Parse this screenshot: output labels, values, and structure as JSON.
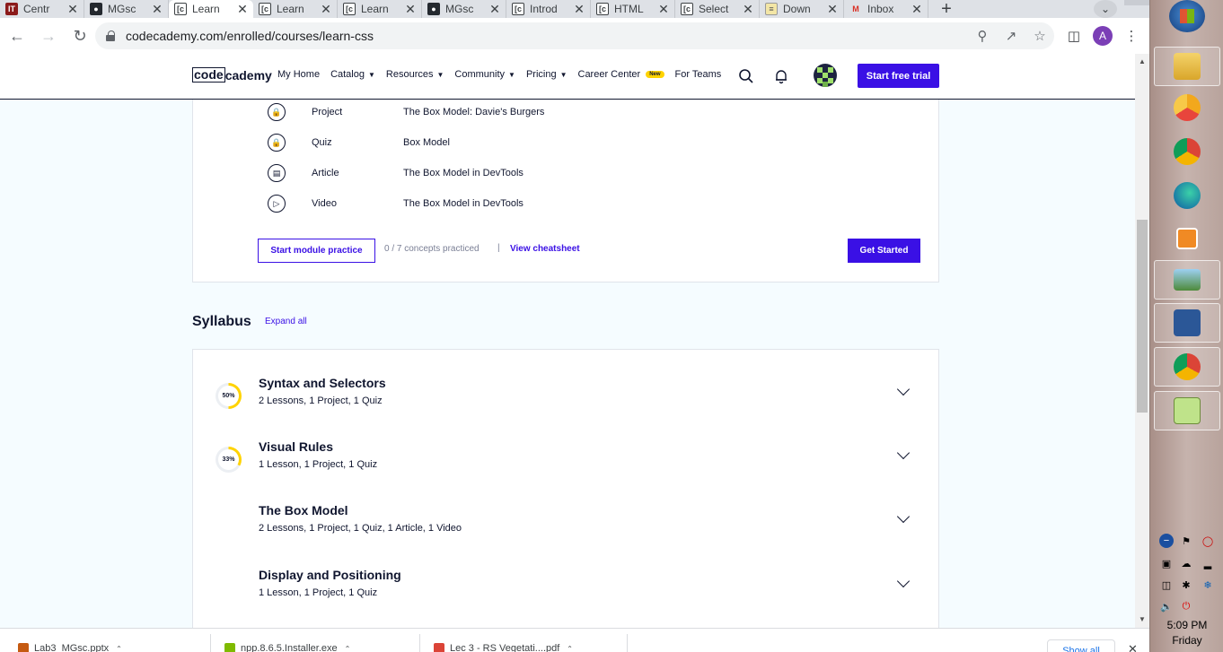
{
  "browser": {
    "tabs": [
      {
        "title": "Centr",
        "favicon": "it-icon",
        "active": false
      },
      {
        "title": "MGsc",
        "favicon": "github-icon",
        "active": false
      },
      {
        "title": "Learn",
        "favicon": "codecademy-icon",
        "active": true
      },
      {
        "title": "Learn",
        "favicon": "codecademy-icon",
        "active": false
      },
      {
        "title": "Learn",
        "favicon": "codecademy-icon",
        "active": false
      },
      {
        "title": "MGsc",
        "favicon": "github-icon",
        "active": false
      },
      {
        "title": "Introd",
        "favicon": "codecademy-icon",
        "active": false
      },
      {
        "title": "HTML",
        "favicon": "codecademy-icon",
        "active": false
      },
      {
        "title": "Select",
        "favicon": "codecademy-icon",
        "active": false
      },
      {
        "title": "Down",
        "favicon": "document-icon",
        "active": false
      },
      {
        "title": "Inbox",
        "favicon": "gmail-icon",
        "active": false
      }
    ],
    "url": "codecademy.com/enrolled/courses/learn-css",
    "profile_initial": "A"
  },
  "site": {
    "logo_code": "code",
    "logo_cademy": "cademy",
    "nav": [
      {
        "label": "My Home",
        "caret": false
      },
      {
        "label": "Catalog",
        "caret": true
      },
      {
        "label": "Resources",
        "caret": true
      },
      {
        "label": "Community",
        "caret": true
      },
      {
        "label": "Pricing",
        "caret": true
      },
      {
        "label": "Career Center",
        "caret": false,
        "badge": "New"
      },
      {
        "label": "For Teams",
        "caret": false
      }
    ],
    "trial_button": "Start free trial"
  },
  "module": {
    "items": [
      {
        "icon": "lock-icon",
        "type": "Project",
        "name": "The Box Model: Davie's Burgers"
      },
      {
        "icon": "lock-icon",
        "type": "Quiz",
        "name": "Box Model"
      },
      {
        "icon": "article-icon",
        "type": "Article",
        "name": "The Box Model in DevTools"
      },
      {
        "icon": "play-icon",
        "type": "Video",
        "name": "The Box Model in DevTools"
      }
    ],
    "practice_button": "Start module practice",
    "practice_count": "0 / 7 concepts practiced",
    "separator": "|",
    "cheatsheet_link": "View cheatsheet",
    "start_button": "Get Started"
  },
  "syllabus": {
    "title": "Syllabus",
    "expand_all": "Expand all",
    "modules": [
      {
        "title": "Syntax and Selectors",
        "subtitle": "2 Lessons, 1 Project, 1 Quiz",
        "progress": "50%",
        "progress_value": 50
      },
      {
        "title": "Visual Rules",
        "subtitle": "1 Lesson, 1 Project, 1 Quiz",
        "progress": "33%",
        "progress_value": 33
      },
      {
        "title": "The Box Model",
        "subtitle": "2 Lessons, 1 Project, 1 Quiz, 1 Article, 1 Video",
        "progress": "",
        "progress_value": null
      },
      {
        "title": "Display and Positioning",
        "subtitle": "1 Lesson, 1 Project, 1 Quiz",
        "progress": "",
        "progress_value": null
      }
    ]
  },
  "downloads": {
    "items": [
      "Lab3_MGsc.pptx",
      "npp.8.6.5.Installer.exe",
      "Lec 3 - RS Vegetati....pdf"
    ],
    "show_all": "Show all"
  },
  "taskbar": {
    "time": "5:09 PM",
    "day": "Friday"
  },
  "colors": {
    "brand": "#3a10e5",
    "navy": "#10162f",
    "page_bg": "#f5fcff",
    "progress": "#ffd300"
  }
}
